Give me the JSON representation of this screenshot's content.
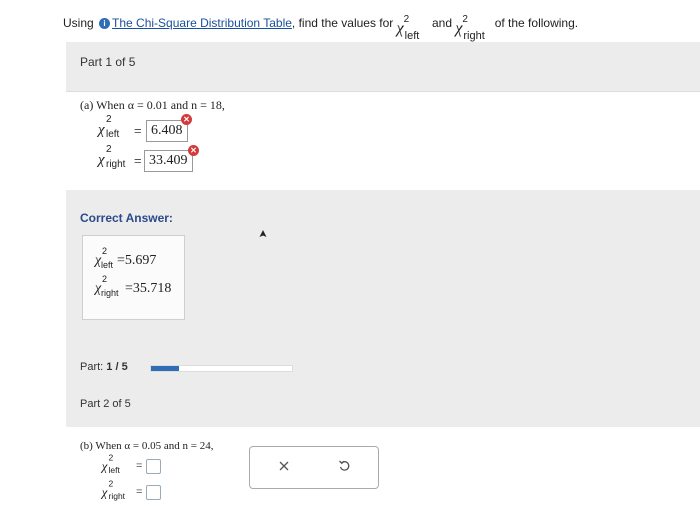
{
  "header": {
    "prefix": "Using",
    "link_text": "The Chi-Square Distribution Table",
    "mid_text": ", find the values for",
    "left_label": "left",
    "and_text": "and",
    "right_label": "right",
    "suffix": "of the following."
  },
  "part1": {
    "title": "Part 1 of 5",
    "question": "(a) When α = 0.01 and n = 18,",
    "left_sub": "left",
    "right_sub": "right",
    "left_answer": "6.408",
    "right_answer": "33.409"
  },
  "correct": {
    "label": "Correct Answer:",
    "left_sub": "left",
    "right_sub": "right",
    "left_value": "=5.697",
    "right_value": "=35.718"
  },
  "progress": {
    "label_prefix": "Part:",
    "label_value": "1 / 5",
    "fraction": 0.2
  },
  "part2": {
    "title": "Part 2 of 5",
    "question": "(b) When α = 0.05 and n = 24,",
    "left_sub": "left",
    "right_sub": "right"
  },
  "icons": {
    "info": "info-circle-icon",
    "incorrect": "x-circle-icon",
    "clear": "close-icon",
    "undo": "undo-icon"
  },
  "colors": {
    "link": "#1a4f9c",
    "accent": "#2f6db5",
    "error": "#d43a3a",
    "correct_label": "#2b4a8b"
  }
}
